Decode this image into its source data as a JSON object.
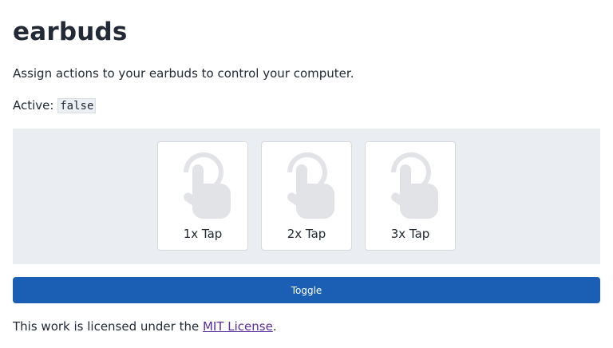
{
  "header": {
    "title": "earbuds"
  },
  "intro": {
    "description": "Assign actions to your earbuds to control your computer."
  },
  "status": {
    "label": "Active: ",
    "value": "false"
  },
  "taps": [
    {
      "label": "1x Tap",
      "icon": "tap-hand-icon"
    },
    {
      "label": "2x Tap",
      "icon": "tap-hand-icon"
    },
    {
      "label": "3x Tap",
      "icon": "tap-hand-icon"
    }
  ],
  "toggle": {
    "label": "Toggle",
    "color": "#1a5fb4"
  },
  "footer": {
    "prefix": "This work is licensed under the ",
    "link_text": "MIT License",
    "suffix": ".",
    "link_color": "#5b2ca0"
  },
  "colors": {
    "panel_background": "#eaedf1",
    "icon_color": "#e1e3e7"
  }
}
